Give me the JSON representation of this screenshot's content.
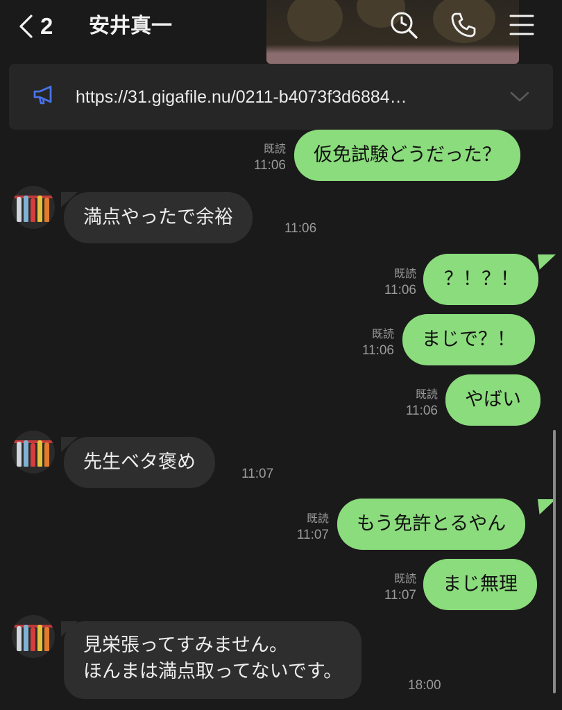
{
  "header": {
    "unread_count": "2",
    "contact_name": "安井真一"
  },
  "announcement": {
    "text": "https://31.gigafile.nu/0211-b4073f3d6884…"
  },
  "messages": [
    {
      "dir": "out",
      "text": "仮免試験どうだった？",
      "read": "既読",
      "time": "11:06"
    },
    {
      "dir": "in",
      "text": "満点やったで余裕",
      "time": "11:06"
    },
    {
      "dir": "out",
      "text": "？！？！",
      "read": "既読",
      "time": "11:06"
    },
    {
      "dir": "out",
      "text": "まじで？！",
      "read": "既読",
      "time": "11:06"
    },
    {
      "dir": "out",
      "text": "やばい",
      "read": "既読",
      "time": "11:06"
    },
    {
      "dir": "in",
      "text": "先生ベタ褒め",
      "time": "11:07"
    },
    {
      "dir": "out",
      "text": "もう免許とるやん",
      "read": "既読",
      "time": "11:07"
    },
    {
      "dir": "out",
      "text": "まじ無理",
      "read": "既読",
      "time": "11:07"
    },
    {
      "dir": "in",
      "text": "見栄張ってすみません。\nほんまは満点取ってないです。",
      "time": "18:00"
    }
  ],
  "colors": {
    "background": "#1a1a1a",
    "outgoing_bubble": "#8bdc7c",
    "incoming_bubble": "#2e2e2e",
    "meta_text": "#9a9a9a",
    "announce_icon": "#4a72e8"
  },
  "icons": {
    "back": "chevron-left-icon",
    "search": "search-icon",
    "call": "phone-icon",
    "menu": "menu-icon",
    "announcement": "megaphone-icon",
    "expand": "chevron-down-icon"
  }
}
